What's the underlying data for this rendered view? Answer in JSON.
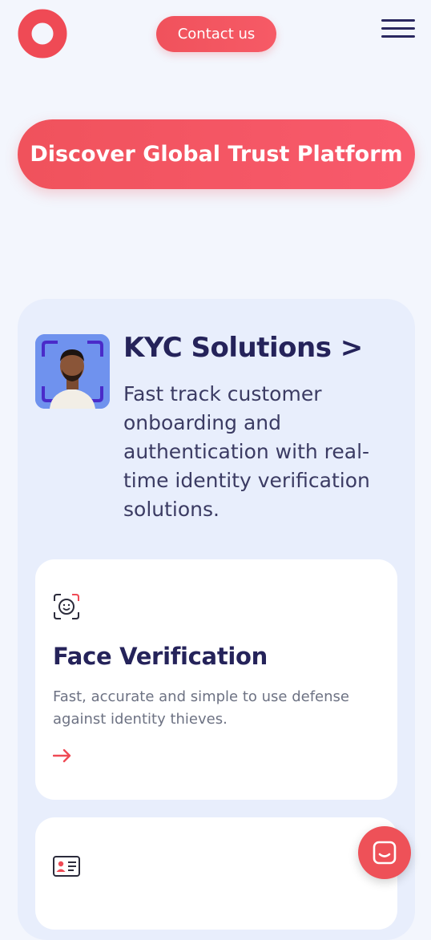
{
  "header": {
    "logo_icon": "ring-logo-icon",
    "contact_label": "Contact us",
    "menu_icon": "hamburger-menu-icon"
  },
  "hero": {
    "cta_label": "Discover Global Trust Platform"
  },
  "kyc": {
    "title": "KYC Solutions >",
    "description": "Fast track customer onboarding and authentication with real-time identity verification solutions."
  },
  "cards": [
    {
      "icon": "face-scan-icon",
      "title": "Face Verification",
      "description": "Fast, accurate and simple to use defense against identity thieves.",
      "link_icon": "arrow-right-icon"
    },
    {
      "icon": "id-card-icon"
    }
  ],
  "chat": {
    "icon": "chat-bubble-icon"
  },
  "colors": {
    "accent": "#f0525c",
    "heading": "#25235a",
    "background": "#f3f6fd",
    "panel": "#e8eefc"
  }
}
